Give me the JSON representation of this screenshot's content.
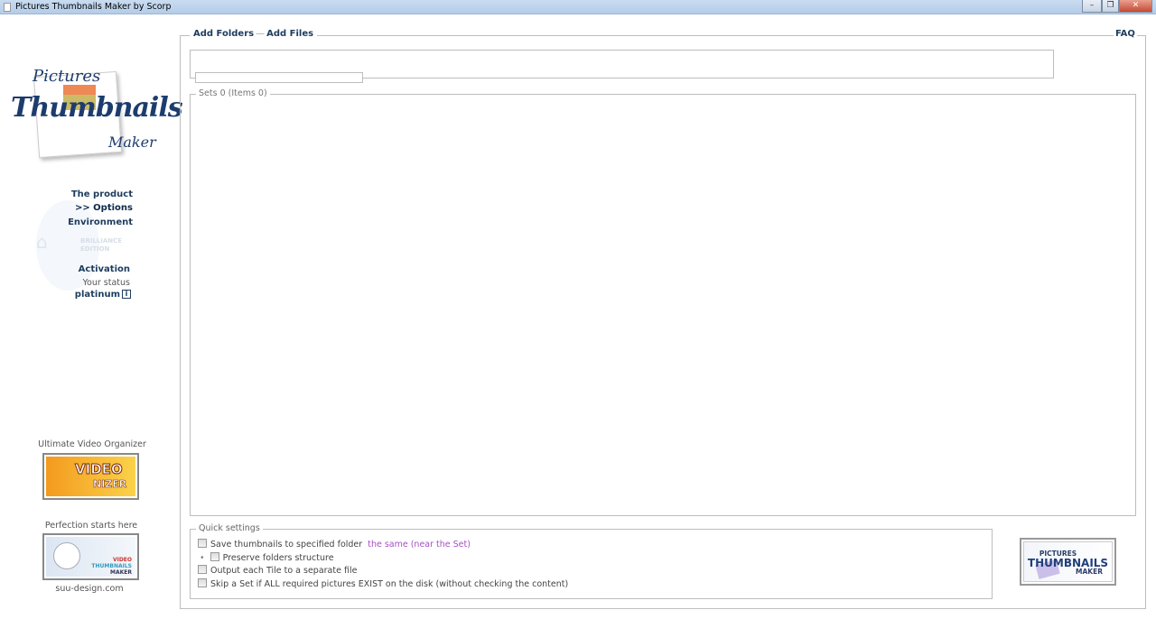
{
  "window": {
    "title": "Pictures Thumbnails Maker by Scorp",
    "minimize": "–",
    "restore": "❐",
    "close": "✕"
  },
  "logo": {
    "line1": "Pictures",
    "line2": "Thumbnails",
    "line3": "Maker"
  },
  "sidebar": {
    "items": [
      {
        "label": "The product"
      },
      {
        "label": ">> Options"
      },
      {
        "label": "Environment"
      }
    ],
    "edition": {
      "line1": "BRILLIANCE",
      "line2": "EDITION"
    },
    "activation": "Activation",
    "status_label": "Your status",
    "status_value": "platinum",
    "info_icon": "i",
    "ad1": {
      "caption": "Ultimate Video Organizer",
      "line1": "VIDEO",
      "line2": "NIZER"
    },
    "ad2": {
      "caption": "Perfection starts here",
      "line1": "VIDEO",
      "line2": "THUMBNAILS",
      "line3": "MAKER"
    },
    "site": "suu-design.com"
  },
  "header": {
    "add_folders": "Add Folders",
    "separator": "—",
    "add_files": "Add Files",
    "faq": "FAQ"
  },
  "sets": {
    "legend": "Sets 0 (Items 0)"
  },
  "quick": {
    "legend": "Quick settings",
    "save_folder": "Save thumbnails to specified folder",
    "save_folder_value": "the same (near the Set)",
    "preserve": "Preserve folders structure",
    "output_tile": "Output each Tile to a separate file",
    "skip": "Skip a Set if ALL required pictures EXIST on the disk (without checking the content)"
  },
  "product_logo": {
    "line1": "PICTURES",
    "line2": "THUMBNAILS",
    "line3": "MAKER"
  },
  "colors": {
    "link": "#1d3c5e",
    "accent": "#a64fc4"
  }
}
